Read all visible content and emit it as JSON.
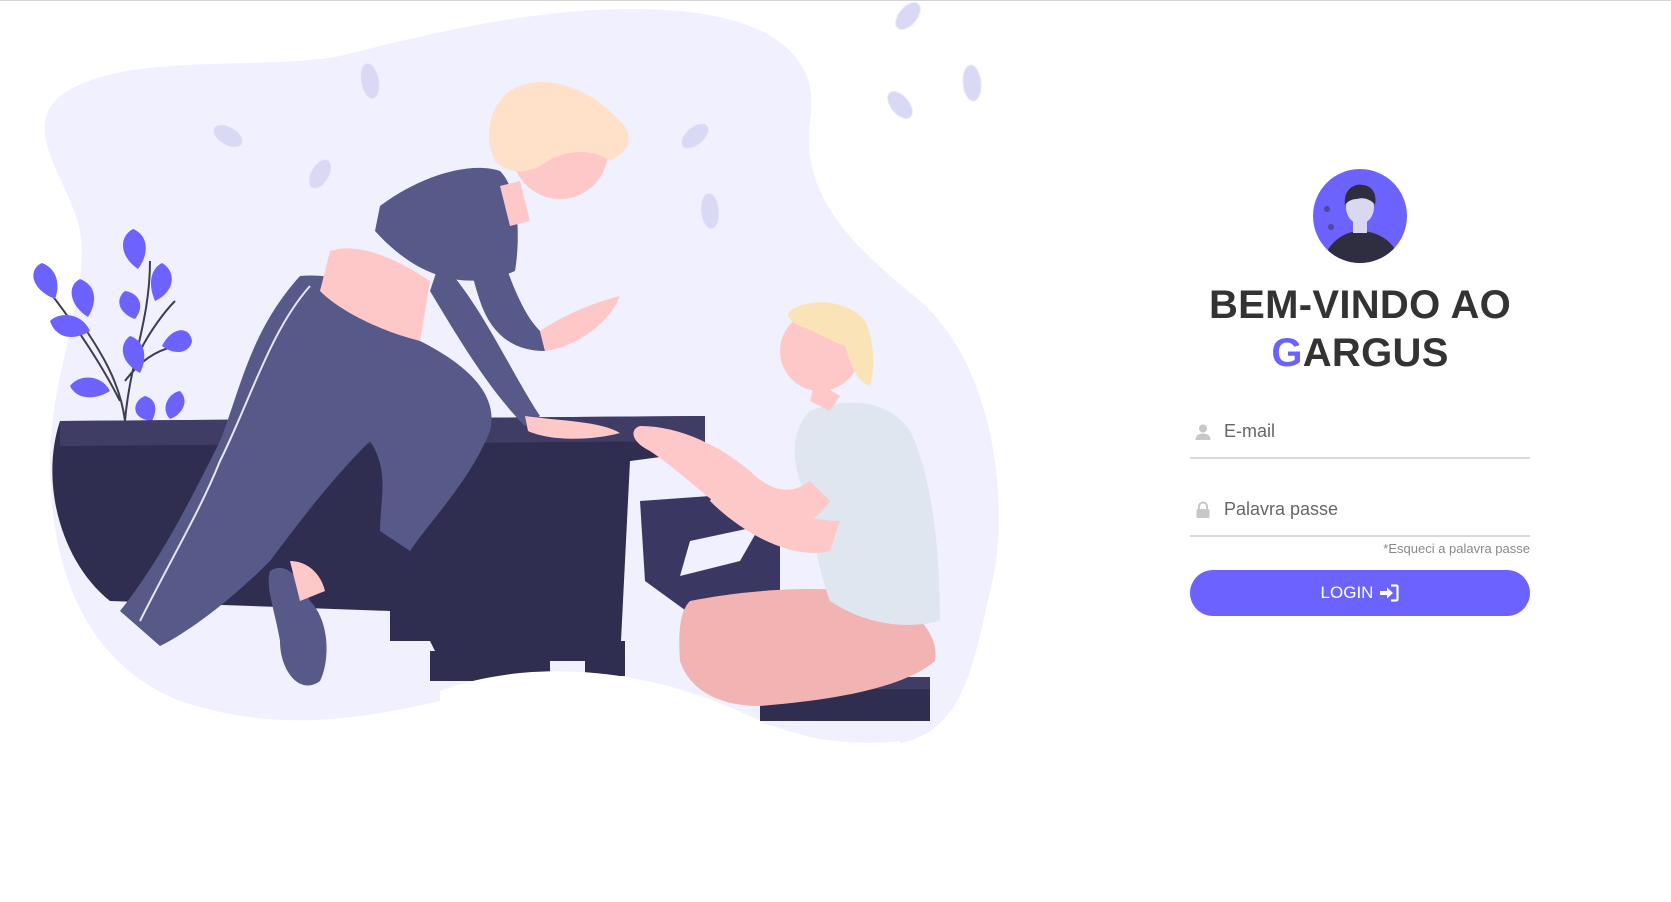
{
  "welcome": {
    "title_line1": "BEM-VINDO AO",
    "title_accent": "G",
    "title_rest": "ARGUS"
  },
  "form": {
    "email_placeholder": "E-mail",
    "password_placeholder": "Palavra passe",
    "forgot_label": "*Esqueci a palavra passe",
    "login_label": "LOGIN"
  },
  "icons": {
    "email": "user-icon",
    "password": "lock-icon",
    "login": "sign-in-icon",
    "avatar": "avatar-icon"
  },
  "colors": {
    "accent": "#6c63ff",
    "title": "#333333",
    "blob": "#f1f0ff",
    "piano": "#2f2e50"
  }
}
